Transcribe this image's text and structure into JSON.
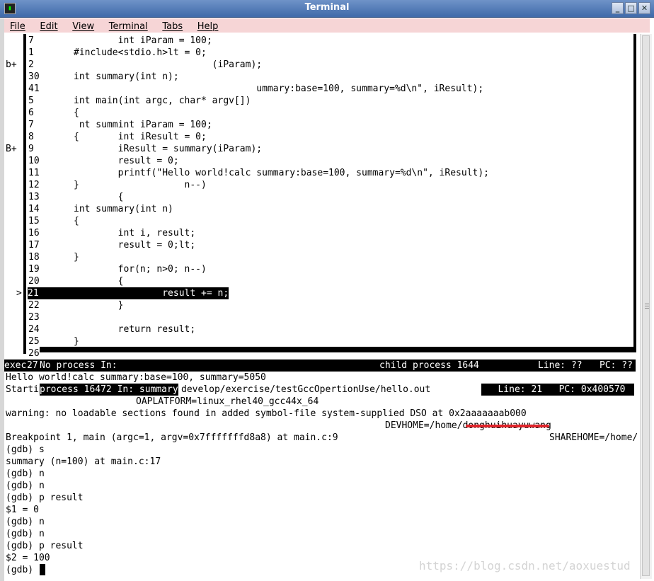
{
  "window": {
    "title": "Terminal"
  },
  "menu": [
    "File",
    "Edit",
    "View",
    "Terminal",
    "Tabs",
    "Help"
  ],
  "source_view": {
    "lines": [
      {
        "marker": "",
        "num": "7",
        "code": "        int iParam = 100;",
        "current": false
      },
      {
        "marker": "",
        "num": "1",
        "code": "#include<stdio.h>lt = 0;",
        "current": false
      },
      {
        "marker": "b+",
        "num": "2",
        "code": "                         (iParam);",
        "current": false
      },
      {
        "marker": "",
        "num": "30",
        "code": "int summary(int n);",
        "current": false
      },
      {
        "marker": "",
        "num": "41",
        "code": "                                 ummary:base=100, summary=%d\\n\", iResult);",
        "current": false
      },
      {
        "marker": "",
        "num": "5",
        "code": "int main(int argc, char* argv[])",
        "current": false
      },
      {
        "marker": "",
        "num": "6",
        "code": "{",
        "current": false
      },
      {
        "marker": "",
        "num": "7",
        "code": " nt summint iParam = 100;",
        "current": false
      },
      {
        "marker": "",
        "num": "8",
        "code": "{       int iResult = 0;",
        "current": false
      },
      {
        "marker": "B+",
        "num": "9",
        "code": "        iResult = summary(iParam);",
        "current": false
      },
      {
        "marker": "",
        "num": "10",
        "code": "        result = 0;",
        "current": false
      },
      {
        "marker": "",
        "num": "11",
        "code": "        printf(\"Hello world!calc summary:base=100, summary=%d\\n\", iResult);",
        "current": false
      },
      {
        "marker": "",
        "num": "12",
        "code": "}                   n--)",
        "current": false
      },
      {
        "marker": "",
        "num": "13",
        "code": "        {",
        "current": false
      },
      {
        "marker": "",
        "num": "14",
        "code": "int summary(int n)",
        "current": false
      },
      {
        "marker": "",
        "num": "15",
        "code": "{",
        "current": false
      },
      {
        "marker": "",
        "num": "16",
        "code": "        int i, result;",
        "current": false
      },
      {
        "marker": "",
        "num": "17",
        "code": "        result = 0;lt;",
        "current": false
      },
      {
        "marker": "",
        "num": "18",
        "code": "}",
        "current": false
      },
      {
        "marker": "",
        "num": "19",
        "code": "        for(n; n>0; n--)",
        "current": false
      },
      {
        "marker": "",
        "num": "20",
        "code": "        {",
        "current": false
      },
      {
        "marker": ">",
        "num": "21",
        "code": "                result += n;",
        "current": true
      },
      {
        "marker": "",
        "num": "22",
        "code": "        }",
        "current": false
      },
      {
        "marker": "",
        "num": "23",
        "code": "",
        "current": false
      },
      {
        "marker": "",
        "num": "24",
        "code": "        return result;",
        "current": false
      },
      {
        "marker": "",
        "num": "25",
        "code": "}",
        "current": false
      },
      {
        "marker": "",
        "num": "26",
        "code": "",
        "current": false
      }
    ]
  },
  "status_bar": {
    "left": "exec",
    "num": "27",
    "process": "No process In:",
    "child": "child process 1644",
    "line": "Line: ??",
    "pc": "PC: ??"
  },
  "output": {
    "hello": "Hello world!calc summary:base=100, summary=5050",
    "starting_prefix": "Starti",
    "starting_inv": "process 16472 In: summary",
    "starting_path": "develop/exercise/testGccOpertionUse/hello.out",
    "status2": "   Line: 21   PC: 0x400570",
    "oaplatform": "OAPLATFORM=linux_rhel40_gcc44x_64",
    "warning": "warning: no loadable sections found in added symbol-file system-supplied DSO at 0x2aaaaaaab000",
    "devhome": "DEVHOME=/home/donghuihuayuwang",
    "breakpoint": "Breakpoint 1, main (argc=1, argv=0x7fffffffd8a8) at main.c:9",
    "sharehome": "SHAREHOME=/home/",
    "session": [
      "(gdb) s",
      "summary (n=100) at main.c:17",
      "(gdb) n",
      "(gdb) n",
      "(gdb) p result",
      "$1 = 0",
      "(gdb) n",
      "(gdb) n",
      "(gdb) p result",
      "$2 = 100"
    ],
    "prompt": "(gdb) "
  },
  "watermark": "https://blog.csdn.net/aoxuestud"
}
